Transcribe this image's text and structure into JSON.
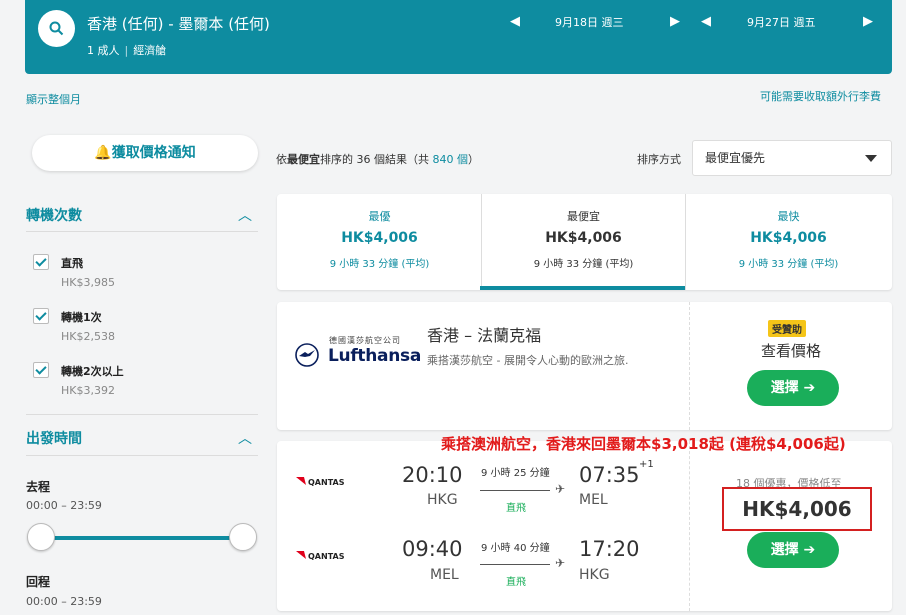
{
  "header": {
    "route": "香港 (任何) - 墨爾本 (任何)",
    "passengers": "1 成人",
    "cabin": "經濟艙",
    "depart_date": "9月18日 週三",
    "return_date": "9月27日 週五"
  },
  "links": {
    "show_month": "顯示整個月",
    "extra_fees": "可能需要收取額外行李費"
  },
  "sidebar": {
    "alert_button": "獲取價格通知",
    "stops_title": "轉機次數",
    "stops": [
      {
        "label": "直飛",
        "price": "HK$3,985"
      },
      {
        "label": "轉機1次",
        "price": "HK$2,538"
      },
      {
        "label": "轉機2次以上",
        "price": "HK$3,392"
      }
    ],
    "times_title": "出發時間",
    "outbound_label": "去程",
    "outbound_range": "00:00 – 23:59",
    "return_label": "回程",
    "return_range": "00:00 – 23:59"
  },
  "results": {
    "prefix": "依",
    "sort_bold": "最便宜",
    "mid": "排序的 36 個結果（共 ",
    "total": "840 個",
    "suffix": "）",
    "sort_label": "排序方式",
    "sort_value": "最便宜優先"
  },
  "tabs": [
    {
      "title": "最優",
      "price": "HK$4,006",
      "duration": "9 小時 33 分鐘 (平均)"
    },
    {
      "title": "最便宜",
      "price": "HK$4,006",
      "duration": "9 小時 33 分鐘 (平均)"
    },
    {
      "title": "最快",
      "price": "HK$4,006",
      "duration": "9 小時 33 分鐘 (平均)"
    }
  ],
  "ad": {
    "airline_small": "德國漢莎航空公司",
    "airline_logo_text": "Lufthansa",
    "title": "香港 – 法蘭克福",
    "subtitle": "乘搭漢莎航空 - 展開令人心動的歐洲之旅.",
    "sponsored": "受贊助",
    "view_price": "查看價格",
    "select": "選擇 ➔"
  },
  "flight": {
    "airline": "QANTAS",
    "outbound": {
      "dep": "20:10",
      "dep_code": "HKG",
      "duration": "9 小時 25 分鐘",
      "stop": "直飛",
      "arr": "07:35",
      "arr_code": "MEL",
      "plus": "+1"
    },
    "inbound": {
      "dep": "09:40",
      "dep_code": "MEL",
      "duration": "9 小時 40 分鐘",
      "stop": "直飛",
      "arr": "17:20",
      "arr_code": "HKG"
    },
    "deals": "18 個優惠，價格低至",
    "price": "HK$4,006",
    "select": "選擇 ➔"
  },
  "promo": "乘搭澳洲航空，香港來回墨爾本$3,018起 (連稅$4,006起)",
  "colors": {
    "accent": "#0e8ca0",
    "green": "#1aae5a",
    "red": "#d42020"
  }
}
